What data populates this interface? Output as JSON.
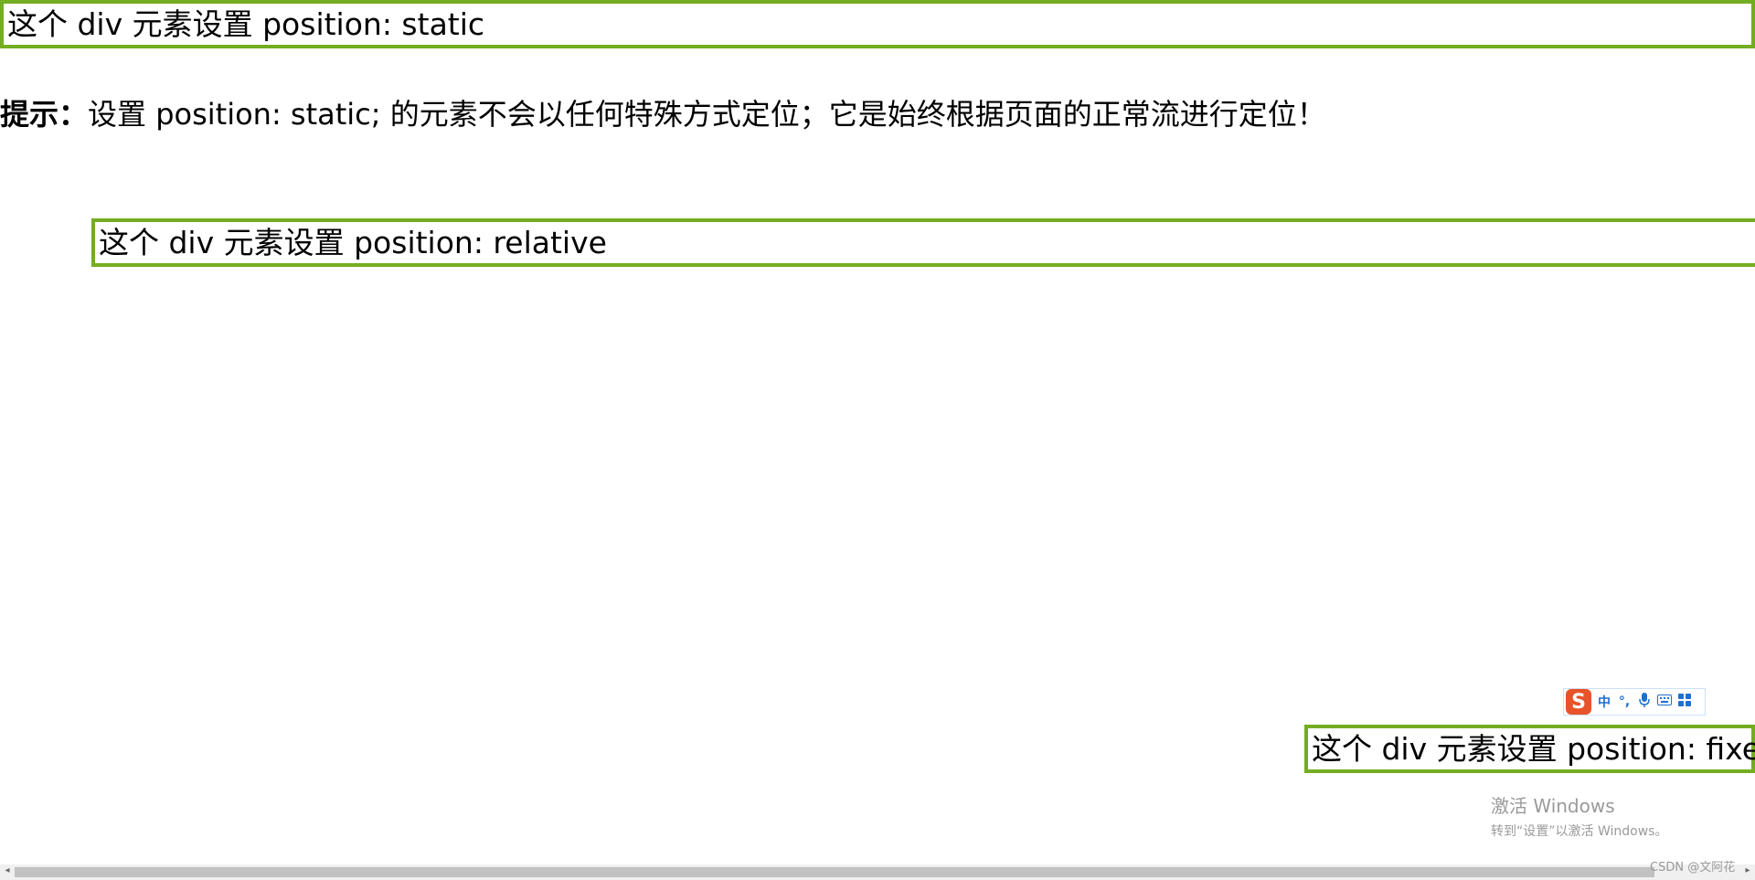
{
  "boxes": {
    "static_text": "这个 div 元素设置 position: static",
    "relative_text": "这个 div 元素设置 position: relative",
    "fixed_text": "这个 div 元素设置 position: fixed"
  },
  "tip": {
    "label": "提示：",
    "text": "设置 position: static; 的元素不会以任何特殊方式定位；它是始终根据页面的正常流进行定位！"
  },
  "ime_toolbar": {
    "logo": "S",
    "mode": "中",
    "items": [
      "punctuation-icon",
      "microphone-icon",
      "keyboard-icon",
      "grid-menu-icon"
    ]
  },
  "watermark": {
    "title": "激活 Windows",
    "subtitle": "转到“设置”以激活 Windows。"
  },
  "credit": "CSDN @文阿花",
  "colors": {
    "border": "#73AD21",
    "ime_logo": "#e8532a",
    "ime_text": "#1f6fd0"
  }
}
